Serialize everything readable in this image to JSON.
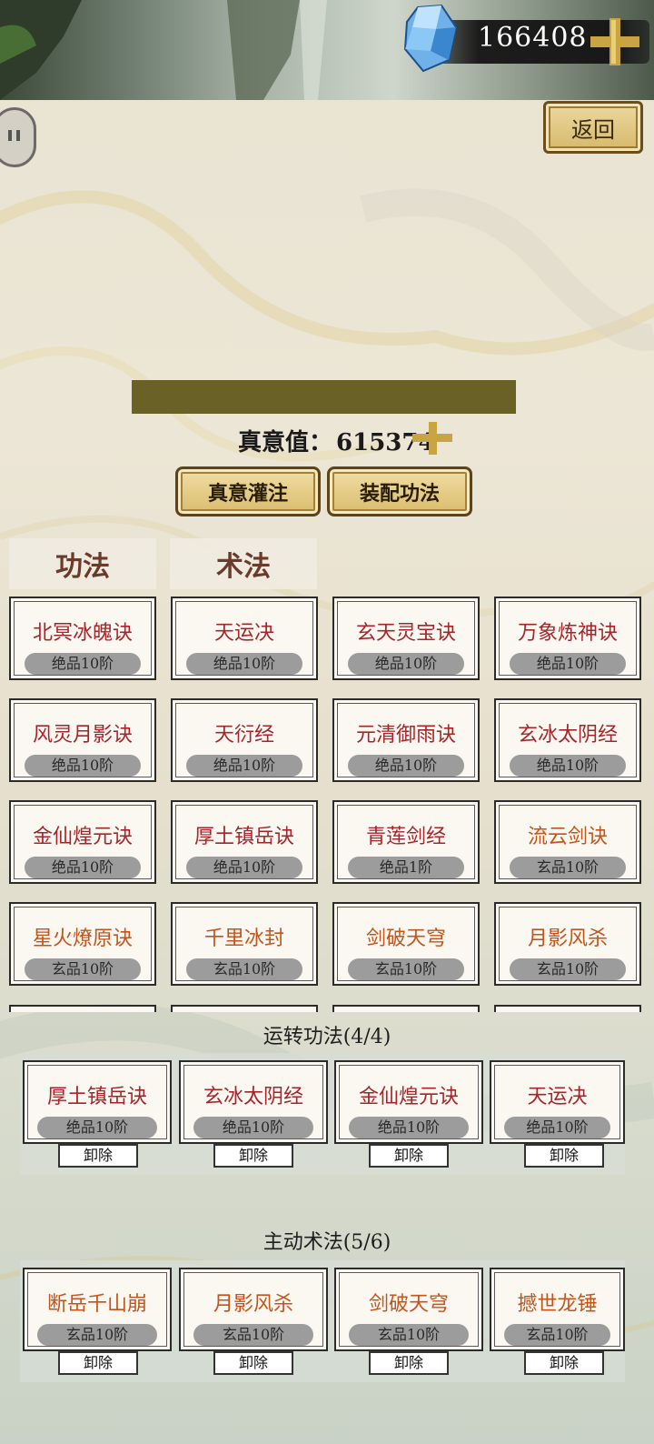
{
  "currency": {
    "amount": "166408",
    "gem_icon": "blue-crystal-icon",
    "add_icon": "gold-plus-icon"
  },
  "header": {
    "return_label": "返回"
  },
  "zhenyi": {
    "label": "真意值：",
    "value": "615374"
  },
  "actions": {
    "infuse_label": "真意灌注",
    "equip_label": "装配功法"
  },
  "tabs": [
    {
      "label": "功法"
    },
    {
      "label": "术法"
    }
  ],
  "skills": [
    {
      "name": "北冥冰魄诀",
      "grade": "绝品10阶",
      "color": "#a7252a"
    },
    {
      "name": "天运决",
      "grade": "绝品10阶",
      "color": "#a7252a"
    },
    {
      "name": "玄天灵宝诀",
      "grade": "绝品10阶",
      "color": "#a7252a"
    },
    {
      "name": "万象炼神诀",
      "grade": "绝品10阶",
      "color": "#a7252a"
    },
    {
      "name": "风灵月影诀",
      "grade": "绝品10阶",
      "color": "#a7252a"
    },
    {
      "name": "天衍经",
      "grade": "绝品10阶",
      "color": "#a7252a"
    },
    {
      "name": "元清御雨诀",
      "grade": "绝品10阶",
      "color": "#a7252a"
    },
    {
      "name": "玄冰太阴经",
      "grade": "绝品10阶",
      "color": "#a7252a"
    },
    {
      "name": "金仙煌元诀",
      "grade": "绝品10阶",
      "color": "#a7252a"
    },
    {
      "name": "厚土镇岳诀",
      "grade": "绝品10阶",
      "color": "#a7252a"
    },
    {
      "name": "青莲剑经",
      "grade": "绝品1阶",
      "color": "#a7252a"
    },
    {
      "name": "流云剑诀",
      "grade": "玄品10阶",
      "color": "#c4541c"
    },
    {
      "name": "星火燎原诀",
      "grade": "玄品10阶",
      "color": "#c4541c"
    },
    {
      "name": "千里冰封",
      "grade": "玄品10阶",
      "color": "#c4541c"
    },
    {
      "name": "剑破天穹",
      "grade": "玄品10阶",
      "color": "#c4541c"
    },
    {
      "name": "月影风杀",
      "grade": "玄品10阶",
      "color": "#c4541c"
    }
  ],
  "running": {
    "title": "运转功法(4/4)",
    "unload_label": "卸除",
    "items": [
      {
        "name": "厚土镇岳诀",
        "grade": "绝品10阶",
        "color": "#a7252a"
      },
      {
        "name": "玄冰太阴经",
        "grade": "绝品10阶",
        "color": "#a7252a"
      },
      {
        "name": "金仙煌元诀",
        "grade": "绝品10阶",
        "color": "#a7252a"
      },
      {
        "name": "天运决",
        "grade": "绝品10阶",
        "color": "#a7252a"
      }
    ]
  },
  "active": {
    "title": "主动术法(5/6)",
    "unload_label": "卸除",
    "items": [
      {
        "name": "断岳千山崩",
        "grade": "玄品10阶",
        "color": "#c4541c"
      },
      {
        "name": "月影风杀",
        "grade": "玄品10阶",
        "color": "#c4541c"
      },
      {
        "name": "剑破天穹",
        "grade": "玄品10阶",
        "color": "#c4541c"
      },
      {
        "name": "撼世龙锤",
        "grade": "玄品10阶",
        "color": "#c4541c"
      }
    ]
  }
}
